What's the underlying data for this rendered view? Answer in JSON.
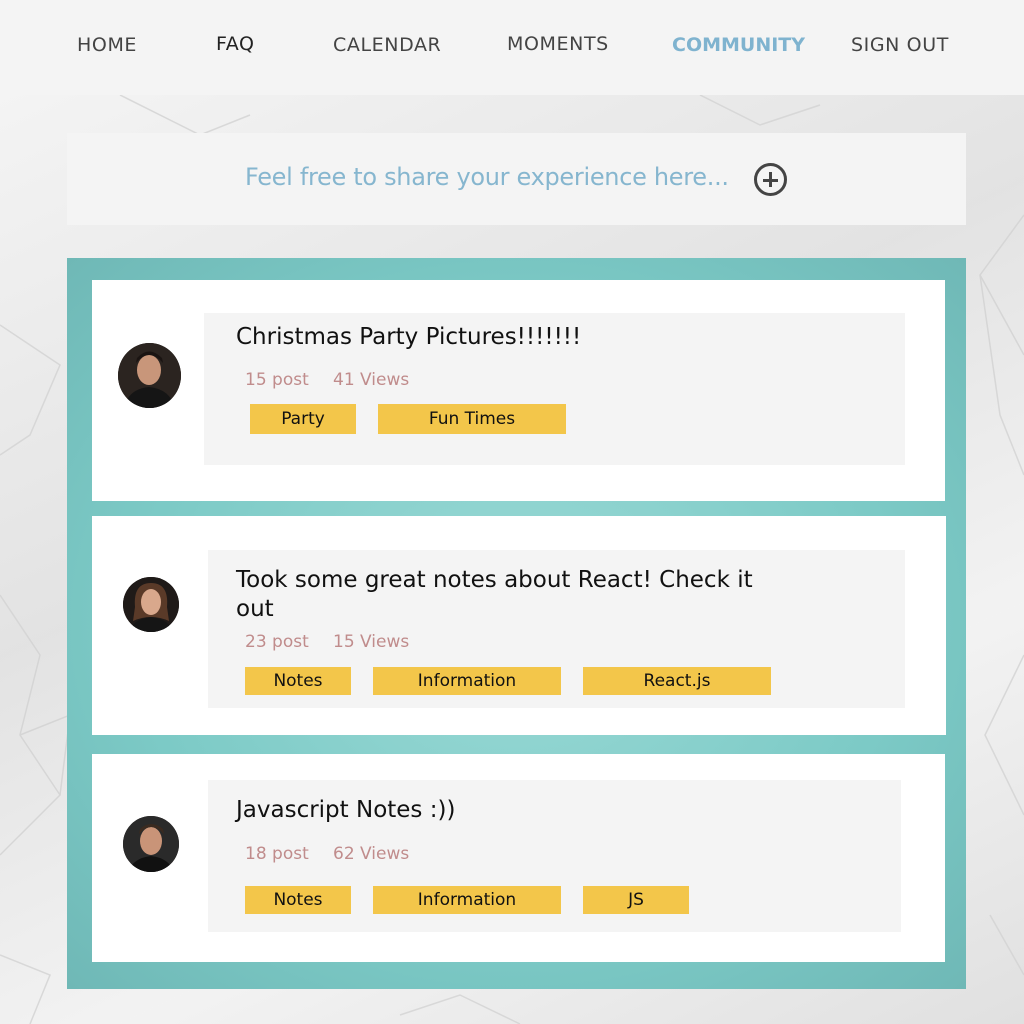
{
  "nav": {
    "home": "HOME",
    "faq": "FAQ",
    "calendar": "CALENDAR",
    "moments": "MOMENTS",
    "community": "COMMUNITY",
    "sign_out": "SIGN OUT"
  },
  "share": {
    "prompt": "Feel free to share your experience here...",
    "add_icon": "plus-circle-icon"
  },
  "posts": [
    {
      "title": "Christmas Party Pictures!!!!!!!",
      "posts": "15 post",
      "views": "41 Views",
      "tags": [
        "Party",
        "Fun Times"
      ]
    },
    {
      "title": "Took some great notes about React! Check it out",
      "posts": "23 post",
      "views": "15 Views",
      "tags": [
        "Notes",
        "Information",
        "React.js"
      ]
    },
    {
      "title": "Javascript Notes :))",
      "posts": "18 post",
      "views": "62 Views",
      "tags": [
        "Notes",
        "Information",
        "JS"
      ]
    }
  ],
  "colors": {
    "accent": "#7fb3cf",
    "tag": "#f3c64a",
    "feed": "#7ccac6",
    "meta": "#c08c8c"
  }
}
